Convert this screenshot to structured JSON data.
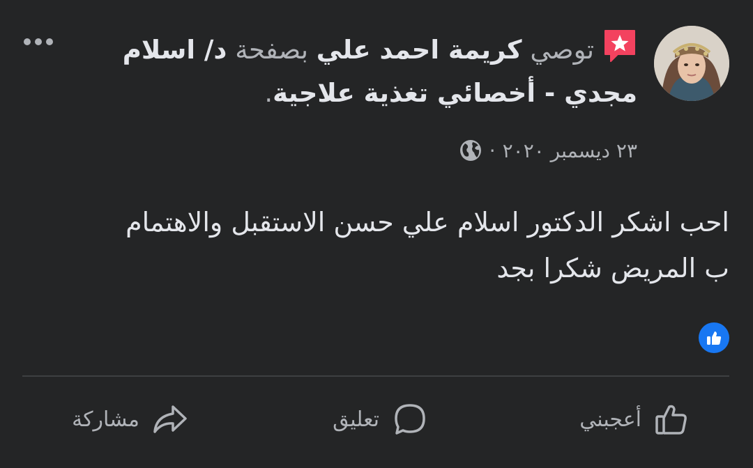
{
  "post": {
    "header": {
      "recommends": "توصي",
      "author": "كريمة احمد علي",
      "on_page": "بصفحة",
      "page_name": "د/ اسلام مجدي - أخصائي تغذية علاجية",
      "period": "."
    },
    "meta": {
      "date": "٢٣ ديسمبر ٢٠٢٠",
      "separator": "·",
      "privacy_icon": "globe-icon"
    },
    "body": {
      "line1": "احب اشكر الدكتور اسلام علي حسن الاستقبل والاهتمام",
      "line2": "ب المريض شكرا بجد"
    },
    "reactions": {
      "icon": "like-reaction-icon"
    }
  },
  "actions": {
    "like_label": "أعجبني",
    "comment_label": "تعليق",
    "share_label": "مشاركة"
  },
  "colors": {
    "background": "#242526",
    "text_primary": "#e4e6eb",
    "text_secondary": "#b0b3b8",
    "accent_blue": "#1877f2",
    "recommend_pink": "#f3425f",
    "divider": "#3e4042"
  }
}
